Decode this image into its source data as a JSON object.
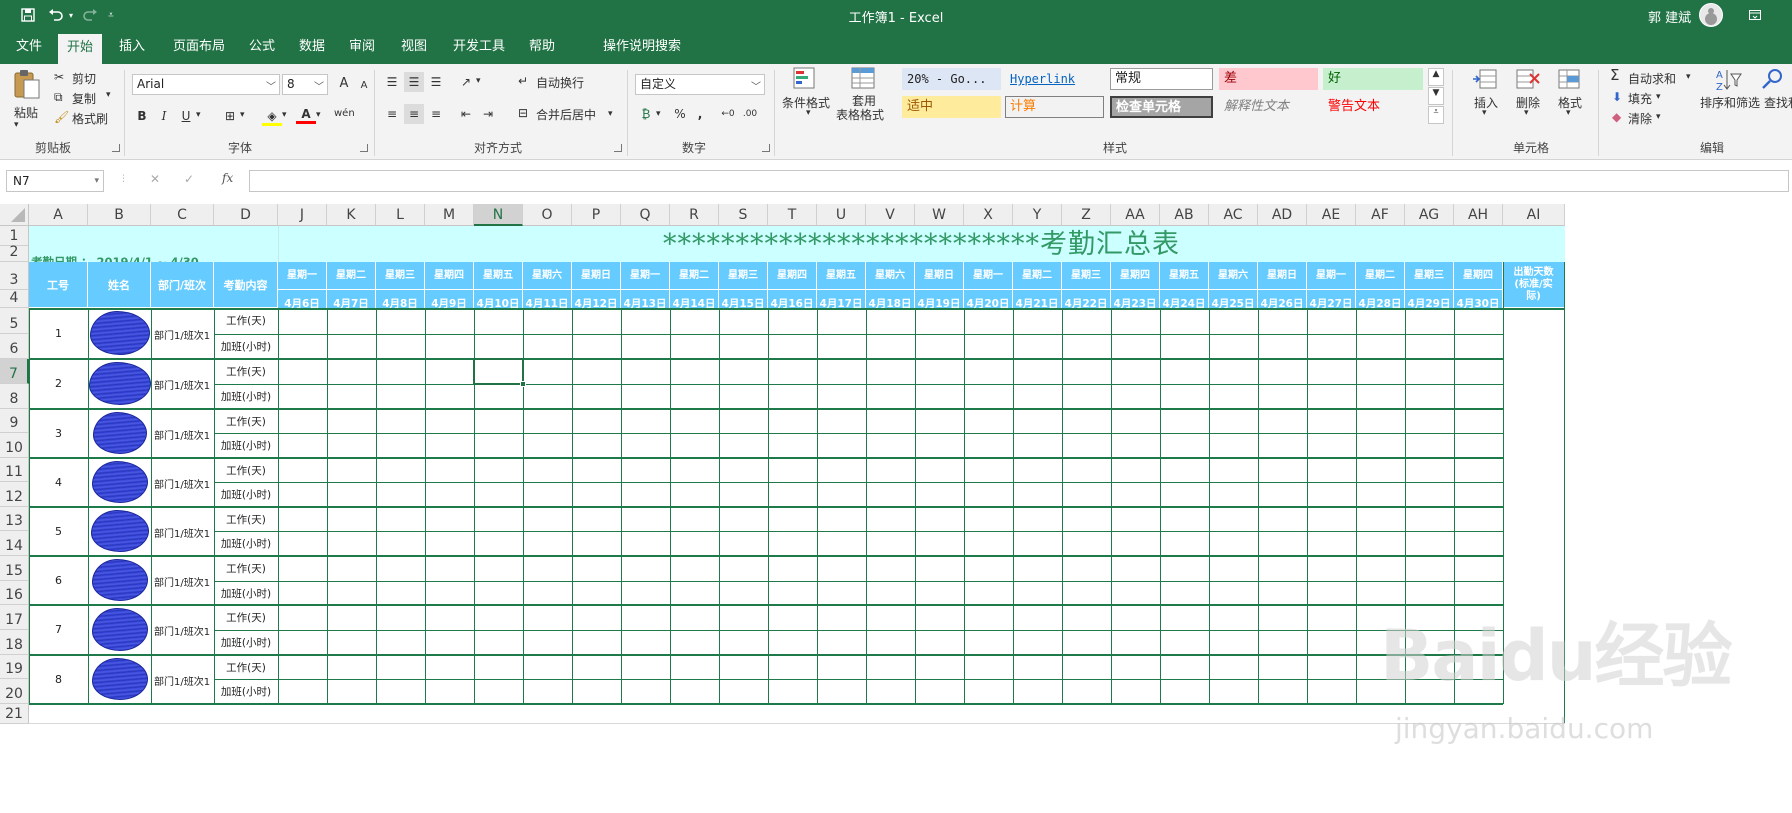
{
  "titlebar": {
    "save_icon": "save-icon",
    "undo_icon": "undo-icon",
    "redo_icon": "redo-icon",
    "customize_icon": "chevron-down-icon",
    "doc_title": "工作簿1  -  Excel",
    "user": "郭 建斌",
    "restore_icon": "ribbon-display-icon",
    "minimize_label": "—",
    "maximize_label": "□",
    "close_label": "✕"
  },
  "tabs": [
    {
      "label": "文件"
    },
    {
      "label": "开始"
    },
    {
      "label": "插入"
    },
    {
      "label": "页面布局"
    },
    {
      "label": "公式"
    },
    {
      "label": "数据"
    },
    {
      "label": "审阅"
    },
    {
      "label": "视图"
    },
    {
      "label": "开发工具"
    },
    {
      "label": "帮助"
    }
  ],
  "tellme": "操作说明搜索",
  "ribbon": {
    "clipboard": {
      "paste": "粘贴",
      "cut": "剪切",
      "copy": "复制",
      "format_painter": "格式刷",
      "group": "剪贴板"
    },
    "font": {
      "name": "Arial",
      "size": "8",
      "group": "字体",
      "bold": "B",
      "italic": "I",
      "underline": "U",
      "grow": "A",
      "shrink": "A"
    },
    "alignment": {
      "wrap": "自动换行",
      "merge": "合并后居中",
      "group": "对齐方式"
    },
    "number": {
      "format": "自定义",
      "group": "数字",
      "percent": "%",
      "comma": ","
    },
    "styles": {
      "conditional": "条件格式",
      "table_1": "套用",
      "table_2": "表格格式",
      "group": "样式",
      "cells": [
        {
          "label": "20% - Go..."
        },
        {
          "label": "Hyperlink"
        },
        {
          "label": "常规"
        },
        {
          "label": "差"
        },
        {
          "label": "好"
        },
        {
          "label": "适中"
        },
        {
          "label": "计算"
        },
        {
          "label": "检查单元格"
        },
        {
          "label": "解释性文本"
        },
        {
          "label": "警告文本"
        }
      ]
    },
    "cells": {
      "insert": "插入",
      "delete": "删除",
      "format": "格式",
      "group": "单元格"
    },
    "editing": {
      "autosum": "自动求和",
      "fill": "填充",
      "clear": "清除",
      "sort": "排序和筛选",
      "find": "查找和",
      "group": "编辑"
    }
  },
  "formula_bar": {
    "name_box": "N7",
    "cancel": "✕",
    "enter": "✓",
    "fx": "fx",
    "value": ""
  },
  "columns": [
    "A",
    "B",
    "C",
    "D",
    "J",
    "K",
    "L",
    "M",
    "N",
    "O",
    "P",
    "Q",
    "R",
    "S",
    "T",
    "U",
    "V",
    "W",
    "X",
    "Y",
    "Z",
    "AA",
    "AB",
    "AC",
    "AD",
    "AE",
    "AF",
    "AG",
    "AH",
    "AI"
  ],
  "rows": [
    "1",
    "2",
    "3",
    "4",
    "5",
    "6",
    "7",
    "8",
    "9",
    "10",
    "11",
    "12",
    "13",
    "14",
    "15",
    "16",
    "17",
    "18",
    "19",
    "20",
    "21"
  ],
  "sheet": {
    "title": "**************************考勤汇总表",
    "date_range": "考勤日期 ： 2019/4/1 ~ 4/30",
    "headers": {
      "id": "工号",
      "name": "姓名",
      "dept": "部门/班次",
      "content": "考勤内容",
      "attendance_1": "出勤天数",
      "attendance_2": "(标准/实",
      "attendance_3": "际)"
    },
    "weekdays": [
      "星期一",
      "星期二",
      "星期三",
      "星期四",
      "星期五",
      "星期六",
      "星期日",
      "星期一",
      "星期二",
      "星期三",
      "星期四",
      "星期五",
      "星期六",
      "星期日",
      "星期一",
      "星期二",
      "星期三",
      "星期四",
      "星期五",
      "星期六",
      "星期日",
      "星期一",
      "星期二",
      "星期三",
      "星期四"
    ],
    "dates": [
      "4月6日",
      "4月7日",
      "4月8日",
      "4月9日",
      "4月10日",
      "4月11日",
      "4月12日",
      "4月13日",
      "4月14日",
      "4月15日",
      "4月16日",
      "4月17日",
      "4月18日",
      "4月19日",
      "4月20日",
      "4月21日",
      "4月22日",
      "4月23日",
      "4月24日",
      "4月25日",
      "4月26日",
      "4月27日",
      "4月28日",
      "4月29日",
      "4月30日"
    ],
    "employees": [
      {
        "id": "1",
        "dept": "部门1/班次1",
        "work": "工作(天)",
        "overtime": "加班(小时)"
      },
      {
        "id": "2",
        "dept": "部门1/班次1",
        "work": "工作(天)",
        "overtime": "加班(小时)"
      },
      {
        "id": "3",
        "dept": "部门1/班次1",
        "work": "工作(天)",
        "overtime": "加班(小时)"
      },
      {
        "id": "4",
        "dept": "部门1/班次1",
        "work": "工作(天)",
        "overtime": "加班(小时)"
      },
      {
        "id": "5",
        "dept": "部门1/班次1",
        "work": "工作(天)",
        "overtime": "加班(小时)"
      },
      {
        "id": "6",
        "dept": "部门1/班次1",
        "work": "工作(天)",
        "overtime": "加班(小时)"
      },
      {
        "id": "7",
        "dept": "部门1/班次1",
        "work": "工作(天)",
        "overtime": "加班(小时)"
      },
      {
        "id": "8",
        "dept": "部门1/班次1",
        "work": "工作(天)",
        "overtime": "加班(小时)"
      }
    ]
  },
  "watermark": {
    "main": "Baidu经验",
    "sub": "jingyan.baidu.com"
  },
  "colors": {
    "excel_green": "#217346",
    "header_blue": "#66ccff",
    "title_band": "#ccffff",
    "border_green": "#1f7a4a",
    "title_text": "#339966"
  }
}
